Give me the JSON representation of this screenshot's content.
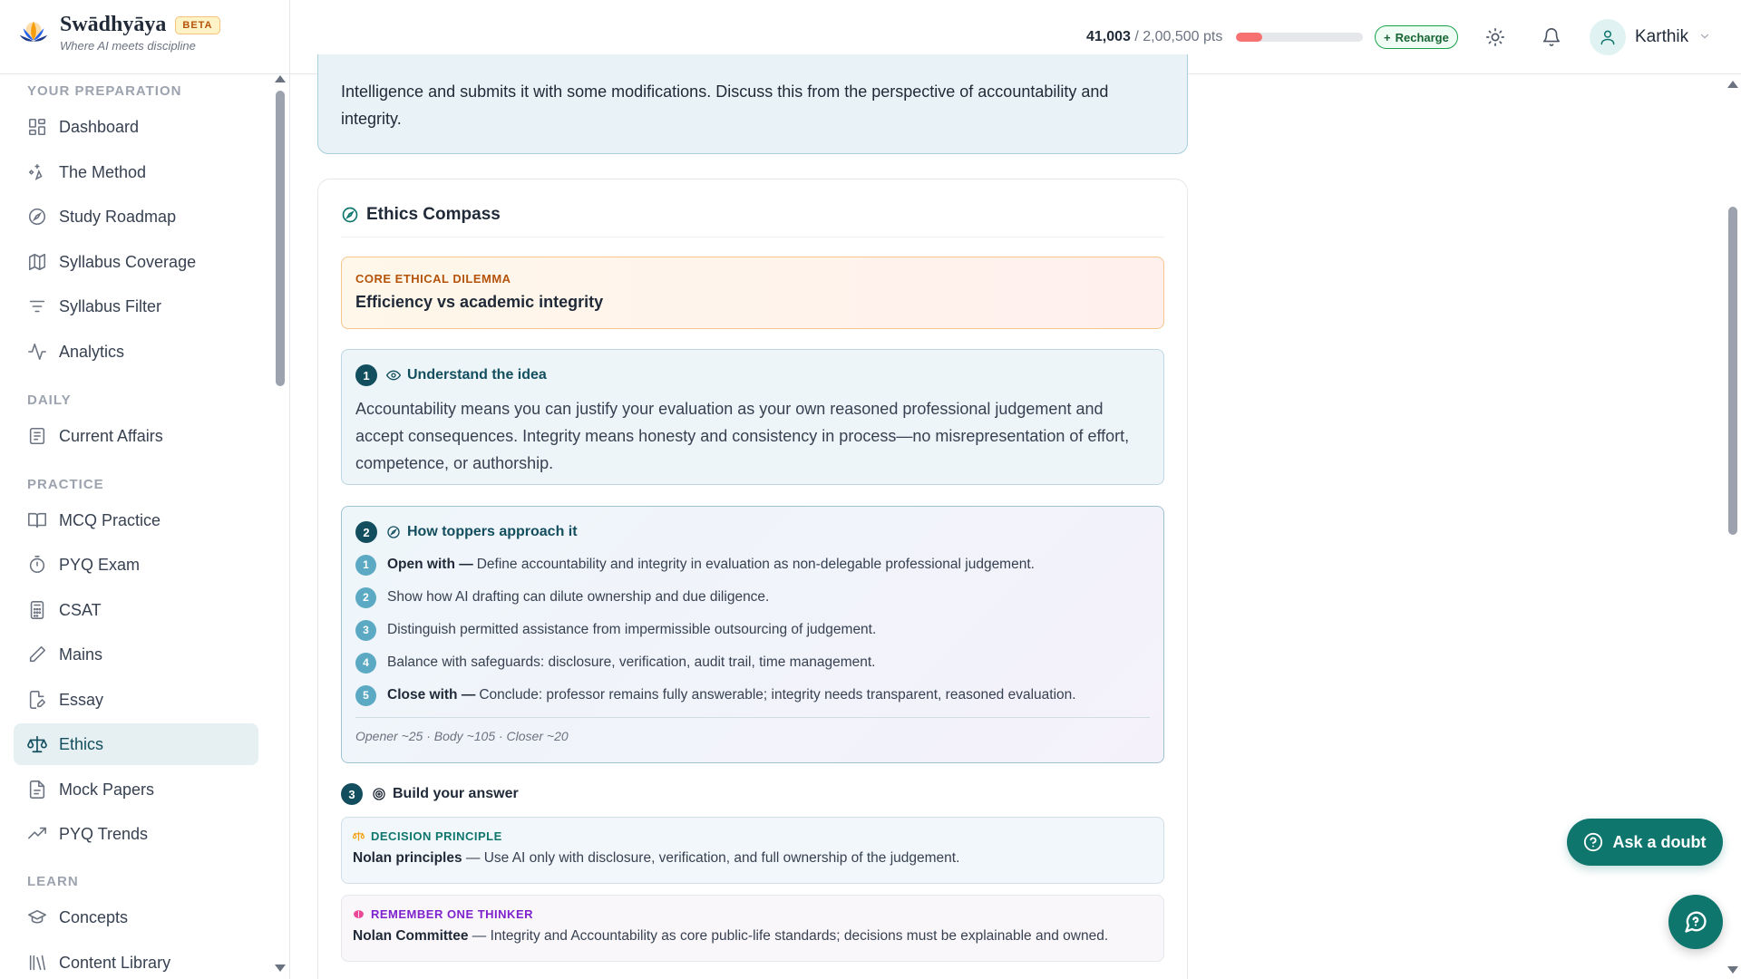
{
  "brand": {
    "name": "Swādhyāya",
    "badge": "BETA",
    "tagline": "Where AI meets discipline"
  },
  "header": {
    "points_current": "41,003",
    "points_total": "/ 2,00,500 pts",
    "points_progress_fraction": 0.2045,
    "recharge_label": "Recharge",
    "user_name": "Karthik"
  },
  "sidebar": {
    "sections": {
      "preparation": "YOUR PREPARATION",
      "daily": "DAILY",
      "practice": "PRACTICE",
      "learn": "LEARN"
    },
    "items": {
      "dashboard": "Dashboard",
      "method": "The Method",
      "roadmap": "Study Roadmap",
      "coverage": "Syllabus Coverage",
      "filter": "Syllabus Filter",
      "analytics": "Analytics",
      "affairs": "Current Affairs",
      "mcq": "MCQ Practice",
      "pyq_exam": "PYQ Exam",
      "csat": "CSAT",
      "mains": "Mains",
      "essay": "Essay",
      "ethics": "Ethics",
      "mock": "Mock Papers",
      "trends": "PYQ Trends",
      "concepts": "Concepts",
      "library": "Content Library"
    }
  },
  "question": {
    "text": "Intelligence and submits it with some modifications. Discuss this from the perspective of accountability and integrity."
  },
  "compass": {
    "title": "Ethics Compass",
    "dilemma_label": "CORE ETHICAL DILEMMA",
    "dilemma_text": "Efficiency vs academic integrity",
    "step1": {
      "num": "1",
      "title": "Understand the idea",
      "body": "Accountability means you can justify your evaluation as your own reasoned professional judgement and accept consequences. Integrity means honesty and consistency in process—no misrepresentation of effort, competence, or authorship."
    },
    "step2": {
      "num": "2",
      "title": "How toppers approach it",
      "tips": [
        {
          "num": "1",
          "lead": "Open with —",
          "text": "Define accountability and integrity in evaluation as non-delegable professional judgement."
        },
        {
          "num": "2",
          "lead": "",
          "text": "Show how AI drafting can dilute ownership and due diligence."
        },
        {
          "num": "3",
          "lead": "",
          "text": "Distinguish permitted assistance from impermissible outsourcing of judgement."
        },
        {
          "num": "4",
          "lead": "",
          "text": "Balance with safeguards: disclosure, verification, audit trail, time management."
        },
        {
          "num": "5",
          "lead": "Close with —",
          "text": "Conclude: professor remains fully answerable; integrity needs transparent, reasoned evaluation."
        }
      ],
      "meta": "Opener ~25 · Body ~105 · Closer ~20"
    },
    "step3": {
      "num": "3",
      "title": "Build your answer",
      "principle_label": "DECISION PRINCIPLE",
      "principle_lead": "Nolan principles",
      "principle_text": " — Use AI only with disclosure, verification, and full ownership of the judgement.",
      "thinker_label": "REMEMBER ONE THINKER",
      "thinker_lead": "Nolan Committee",
      "thinker_text": " — Integrity and Accountability as core public-life standards; decisions must be explainable and owned."
    }
  },
  "actions": {
    "ask_doubt": "Ask a doubt"
  },
  "colors": {
    "accent": "#0f766e",
    "nav_active_bg": "#e6f0f3",
    "dilemma_border": "#f6c58a",
    "points_fill": "#f87171"
  }
}
